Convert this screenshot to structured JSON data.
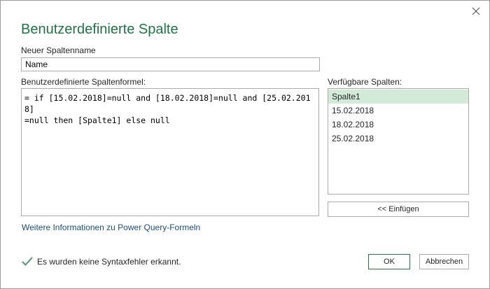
{
  "dialog": {
    "title": "Benutzerdefinierte Spalte",
    "close_icon": "close-icon"
  },
  "column_name": {
    "label": "Neuer Spaltenname",
    "value": "Name"
  },
  "formula": {
    "label": "Benutzerdefinierte Spaltenformel:",
    "value": "= if [15.02.2018]=null and [18.02.2018]=null and [25.02.2018]\n=null then [Spalte1] else null"
  },
  "available_columns": {
    "label": "Verfügbare Spalten:",
    "items": [
      "Spalte1",
      "15.02.2018",
      "18.02.2018",
      "25.02.2018"
    ],
    "selected": "Spalte1"
  },
  "insert_button": "<< Einfügen",
  "more_info_link": "Weitere Informationen zu Power Query-Formeln",
  "status": {
    "icon": "checkmark-icon",
    "text": "Es wurden keine Syntaxfehler erkannt."
  },
  "buttons": {
    "ok": "OK",
    "cancel": "Abbrechen"
  },
  "colors": {
    "accent": "#217346",
    "selection": "#d3ead9",
    "link": "#1e4e79",
    "status_check": "#4f9a6a"
  }
}
